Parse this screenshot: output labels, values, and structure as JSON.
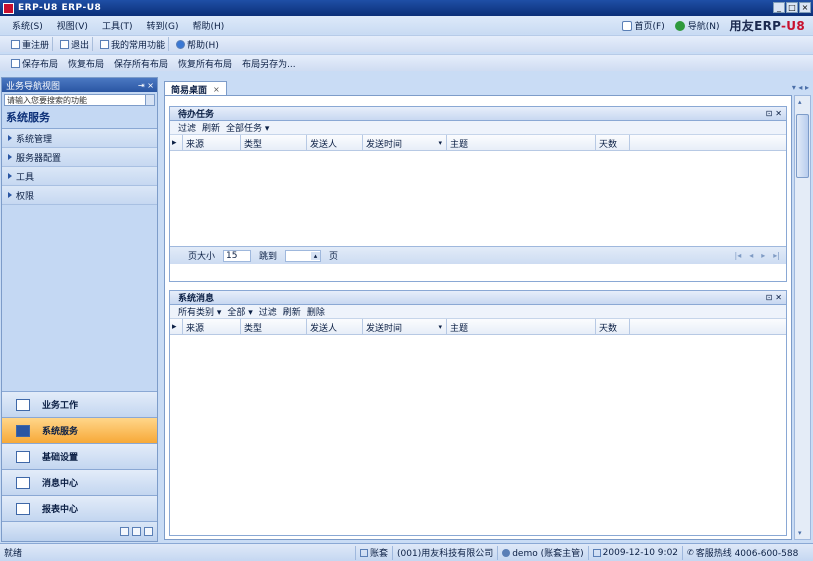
{
  "window": {
    "title": "ERP-U8 ERP-U8",
    "controls": [
      "_",
      "□",
      "×"
    ]
  },
  "menubar": {
    "items": [
      "系统(S)",
      "视图(V)",
      "工具(T)",
      "转到(G)",
      "帮助(H)"
    ]
  },
  "right_tools": {
    "home": "首页(F)",
    "nav": "导航(N)"
  },
  "logo": {
    "brand": "用友ERP",
    "dash": "-",
    "suffix": "U8"
  },
  "toolbar1": {
    "items": [
      "重注册",
      "退出",
      "我的常用功能",
      "帮助(H)"
    ]
  },
  "toolbar2": {
    "items": [
      "保存布局",
      "恢复布局",
      "保存所有布局",
      "恢复所有布局",
      "布局另存为..."
    ]
  },
  "nav": {
    "header": "业务导航视图",
    "search_placeholder": "请输入您要搜索的功能",
    "section_title": "系统服务",
    "tree": [
      "系统管理",
      "服务器配置",
      "工具",
      "权限"
    ],
    "big_buttons": [
      {
        "label": "业务工作",
        "active": false
      },
      {
        "label": "系统服务",
        "active": true
      },
      {
        "label": "基础设置",
        "active": false
      },
      {
        "label": "消息中心",
        "active": false
      },
      {
        "label": "报表中心",
        "active": false
      }
    ]
  },
  "tabs": {
    "desk": "简易桌面"
  },
  "panel1": {
    "title": "待办任务",
    "tools": [
      "过滤",
      "刷新",
      "全部任务 ▾"
    ],
    "columns": [
      "来源",
      "类型",
      "发送人",
      "发送时间",
      "主题",
      "天数"
    ],
    "pager": {
      "size_label": "页大小",
      "size_value": "15",
      "goto_label": "跳到",
      "goto_value": "",
      "page_unit": "页"
    }
  },
  "panel2": {
    "title": "系统消息",
    "tools": [
      "所有类别 ▾",
      "全部 ▾",
      "过滤",
      "刷新",
      "删除"
    ],
    "columns": [
      "来源",
      "类型",
      "发送人",
      "发送时间",
      "主题",
      "天数"
    ]
  },
  "status": {
    "left": "就绪",
    "account": "账套",
    "company": "(001)用友科技有限公司",
    "operator": "demo (账套主管)",
    "date": "2009-12-10 9:02",
    "hotline": "客服热线 4006-600-588"
  }
}
